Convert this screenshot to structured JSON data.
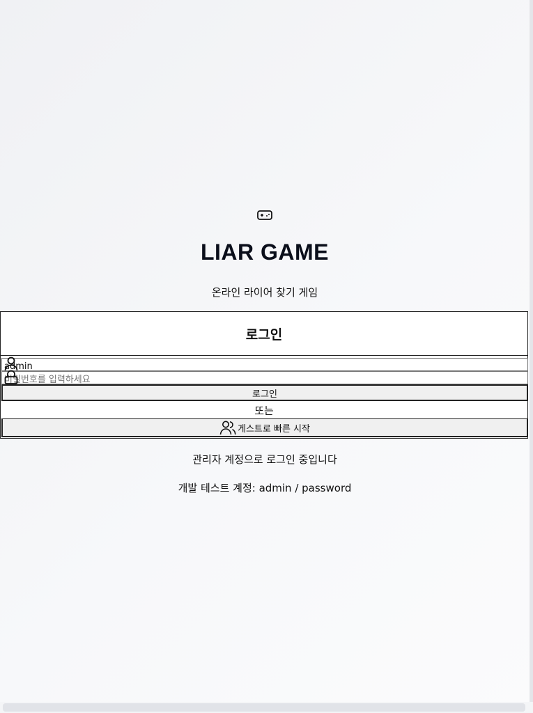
{
  "header": {
    "icon": "gamepad-icon",
    "title": "LIAR GAME",
    "subtitle": "온라인 라이어 찾기 게임"
  },
  "login_card": {
    "title": "로그인",
    "username": {
      "icon": "user-icon",
      "value": "admin"
    },
    "password": {
      "icon": "lock-icon",
      "placeholder": "비밀번호를 입력하세요",
      "value": ""
    },
    "login_button": "로그인",
    "divider": "또는",
    "guest_button": {
      "icon": "users-icon",
      "label": "게스트로 빠른 시작"
    }
  },
  "status_text": "관리자 계정으로 로그인 중입니다",
  "dev_hint": "개발 테스트 계정: admin / password"
}
